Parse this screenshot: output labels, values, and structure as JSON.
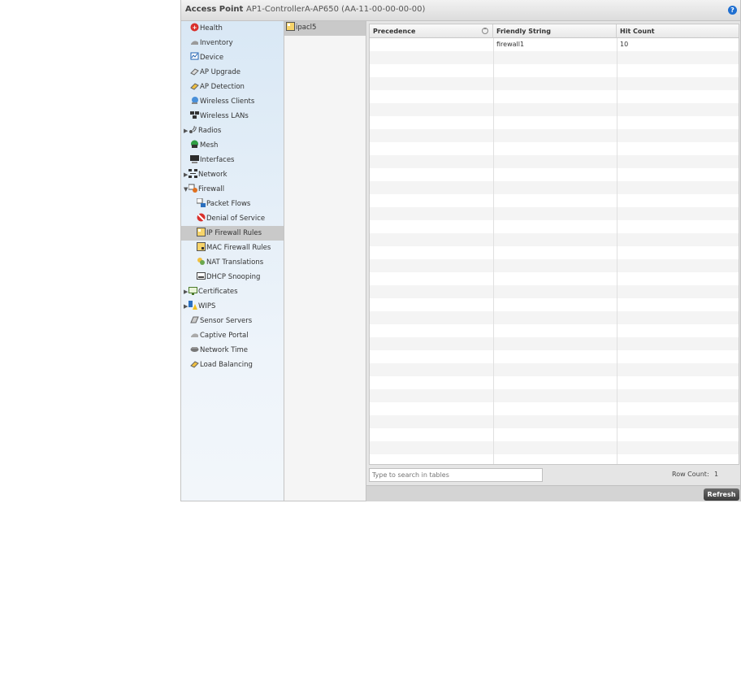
{
  "header": {
    "title": "Access Point",
    "device": "AP1-ControllerA-AP650 (AA-11-00-00-00-00)",
    "help_label": "?"
  },
  "nav": {
    "items": [
      {
        "label": "Health",
        "icon": "health-icon"
      },
      {
        "label": "Inventory",
        "icon": "inventory-icon"
      },
      {
        "label": "Device",
        "icon": "device-icon"
      },
      {
        "label": "AP Upgrade",
        "icon": "ap-upgrade-icon"
      },
      {
        "label": "AP Detection",
        "icon": "ap-detection-icon"
      },
      {
        "label": "Wireless Clients",
        "icon": "wireless-clients-icon"
      },
      {
        "label": "Wireless LANs",
        "icon": "wireless-lans-icon"
      },
      {
        "label": "Radios",
        "icon": "radios-icon",
        "expander": "▶"
      },
      {
        "label": "Mesh",
        "icon": "mesh-icon"
      },
      {
        "label": "Interfaces",
        "icon": "interfaces-icon"
      },
      {
        "label": "Network",
        "icon": "network-icon",
        "expander": "▶"
      },
      {
        "label": "Firewall",
        "icon": "firewall-icon",
        "expander": "▼"
      },
      {
        "label": "Packet Flows",
        "icon": "packet-flows-icon"
      },
      {
        "label": "Denial of Service",
        "icon": "denial-of-service-icon"
      },
      {
        "label": "IP Firewall Rules",
        "icon": "ip-firewall-rules-icon",
        "selected": true
      },
      {
        "label": "MAC Firewall Rules",
        "icon": "mac-firewall-rules-icon"
      },
      {
        "label": "NAT Translations",
        "icon": "nat-translations-icon"
      },
      {
        "label": "DHCP Snooping",
        "icon": "dhcp-snooping-icon"
      },
      {
        "label": "Certificates",
        "icon": "certificates-icon",
        "expander": "▶"
      },
      {
        "label": "WIPS",
        "icon": "wips-icon",
        "expander": "▶"
      },
      {
        "label": "Sensor Servers",
        "icon": "sensor-servers-icon"
      },
      {
        "label": "Captive Portal",
        "icon": "captive-portal-icon"
      },
      {
        "label": "Network Time",
        "icon": "network-time-icon"
      },
      {
        "label": "Load Balancing",
        "icon": "load-balancing-icon"
      }
    ]
  },
  "acl_list": {
    "items": [
      {
        "label": "ipacl5"
      }
    ]
  },
  "table": {
    "columns": [
      "Precedence",
      "Friendly String",
      "Hit Count"
    ],
    "sort_indicator": "⌃",
    "rows": [
      [
        "",
        "firewall1",
        "10"
      ]
    ]
  },
  "search": {
    "placeholder": "Type to search in tables"
  },
  "row_count": {
    "label": "Row Count:",
    "value": "1"
  },
  "footer": {
    "refresh_label": "Refresh"
  },
  "colors": {
    "accent": "#1f6fd1",
    "nav_bg": "#d9e8f5",
    "selected": "#c9c9c9"
  }
}
